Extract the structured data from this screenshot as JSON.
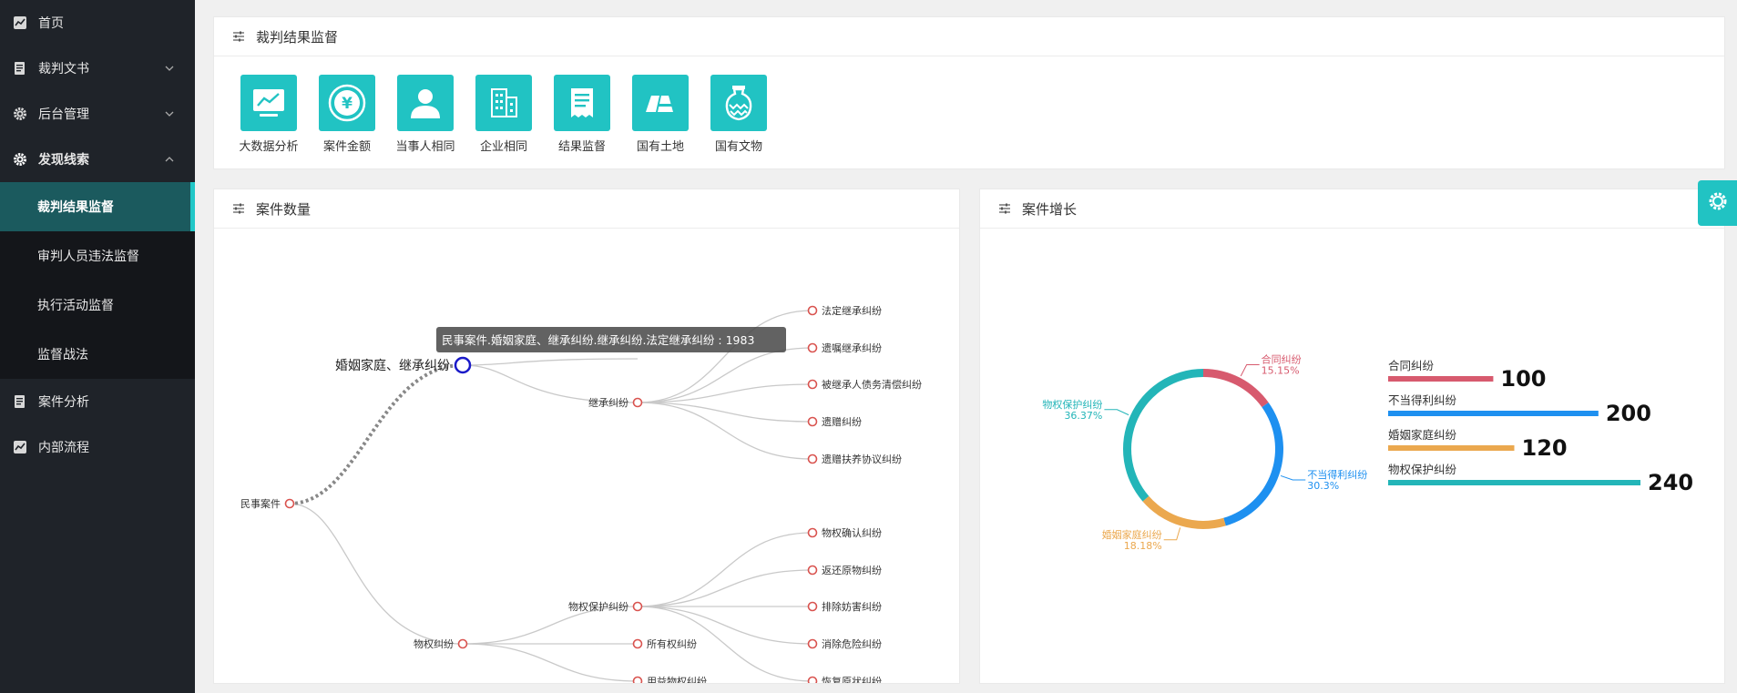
{
  "sidebar": {
    "items": [
      {
        "label": "首页",
        "icon": "chart-line-icon"
      },
      {
        "label": "裁判文书",
        "icon": "document-icon",
        "expand": "down"
      },
      {
        "label": "后台管理",
        "icon": "gear-icon",
        "expand": "down"
      },
      {
        "label": "发现线索",
        "icon": "gear-icon",
        "expand": "up"
      }
    ],
    "submenu": [
      "裁判结果监督",
      "审判人员违法监督",
      "执行活动监督",
      "监督战法"
    ],
    "items_after": [
      {
        "label": "案件分析",
        "icon": "document-icon"
      },
      {
        "label": "内部流程",
        "icon": "chart-line-icon"
      }
    ]
  },
  "top_panel": {
    "title": "裁判结果监督",
    "quick_links": [
      {
        "label": "大数据分析",
        "icon": "trend-chart-icon"
      },
      {
        "label": "案件金额",
        "icon": "yuan-coin-icon"
      },
      {
        "label": "当事人相同",
        "icon": "person-icon"
      },
      {
        "label": "企业相同",
        "icon": "building-icon"
      },
      {
        "label": "结果监督",
        "icon": "receipt-icon"
      },
      {
        "label": "国有土地",
        "icon": "land-icon"
      },
      {
        "label": "国有文物",
        "icon": "vase-icon"
      }
    ]
  },
  "tree_panel": {
    "title": "案件数量",
    "root": "民事案件",
    "marriage": {
      "label": "婚姻家庭、继承纠纷",
      "child": "继承纠纷",
      "leaves": [
        "法定继承纠纷",
        "遗嘱继承纠纷",
        "被继承人债务清偿纠纷",
        "遗赠纠纷",
        "遗赠扶养协议纠纷"
      ]
    },
    "property": {
      "label": "物权纠纷",
      "child": "物权保护纠纷",
      "child2": "所有权纠纷",
      "child3": "用益物权纠纷",
      "leaves": [
        "物权确认纠纷",
        "返还原物纠纷",
        "排除妨害纠纷",
        "消除危险纠纷",
        "恢复原状纠纷"
      ]
    },
    "tooltip": "民事案件.婚姻家庭、继承纠纷.继承纠纷.法定继承纠纷 : 1983"
  },
  "growth_panel": {
    "title": "案件增长"
  },
  "chart_data": {
    "type": "pie",
    "donut": true,
    "slices": [
      {
        "name": "合同纠纷",
        "value": 100,
        "percent": "15.15%",
        "color": "#d75a6e"
      },
      {
        "name": "不当得利纠纷",
        "value": 200,
        "percent": "30.3%",
        "color": "#1e90f0"
      },
      {
        "name": "婚姻家庭纠纷",
        "value": 120,
        "percent": "18.18%",
        "color": "#eba84e"
      },
      {
        "name": "物权保护纠纷",
        "value": 240,
        "percent": "36.37%",
        "color": "#23b5b8"
      }
    ]
  },
  "colors": {
    "accent": "#21c3c3",
    "sidebar_bg": "#1f2329",
    "tree_node": "#d9534f",
    "highlight_node": "#1a1ac8"
  }
}
